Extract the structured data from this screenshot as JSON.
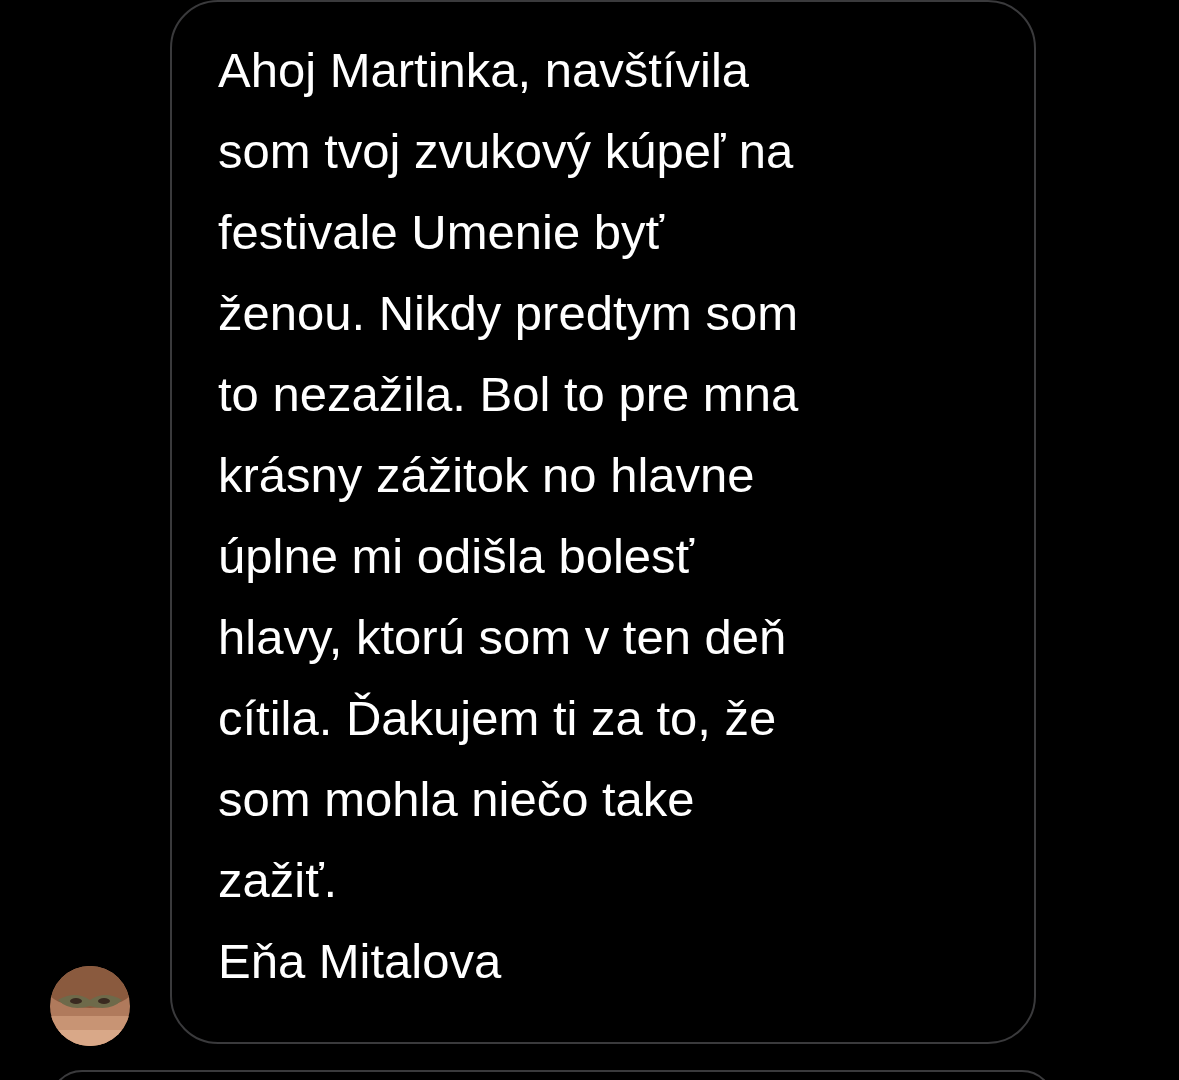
{
  "messages": [
    {
      "lines": [
        "Ahoj Martinka, navštívila",
        "som tvoj zvukový kúpeľ na",
        "festivale Umenie byť",
        "ženou. Nikdy predtym som",
        "to nezažila. Bol to pre mna",
        "krásny zážitok no hlavne",
        "úplne mi odišla bolesť",
        "hlavy, ktorú som v ten deň",
        "cítila. Ďakujem ti za to, že",
        "som mohla niečo take",
        "zažiť.",
        "Eňa Mitalova"
      ]
    }
  ]
}
